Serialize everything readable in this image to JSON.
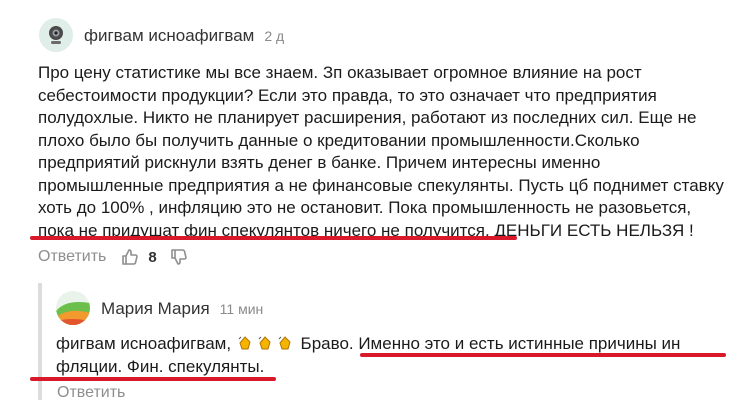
{
  "comment": {
    "author": "фигвам исноафигвам",
    "time": "2 д",
    "text_lines": [
      "Про цену статистике мы все знаем. Зп оказывает огромное влияние на рост",
      "себестоимости продукции? Если это правда, то это означает что предприятия",
      "полудохлые. Никто не планирует расширения, работают из последних сил. Еще не",
      "плохо было бы получить данные о кредитовании промышленности.Сколько",
      "предприятий рискнули взять денег в банке. Причем интересны именно",
      "промышленные предприятия а не финансовые спекулянты. Пусть цб поднимет ставку",
      "хоть до 100% , инфляцию это не остановит. Пока промышленность не разовьется,",
      "пока не придушат фин спекулянтов ничего не получится. ДЕНЬГИ ЕСТЬ НЕЛЬЗЯ !"
    ],
    "reply_label": "Ответить",
    "likes": "8"
  },
  "reply": {
    "author": "Мария Мария",
    "time": "11 мин",
    "mention": "фигвам исноафигвам,",
    "text_after": " Браво. Именно это и есть истинные причины ин",
    "line2": "фляции. Фин. спекулянты.",
    "reply_label": "Ответить"
  },
  "colors": {
    "highlight": "#d9192a",
    "muted": "#8e8e8e"
  }
}
